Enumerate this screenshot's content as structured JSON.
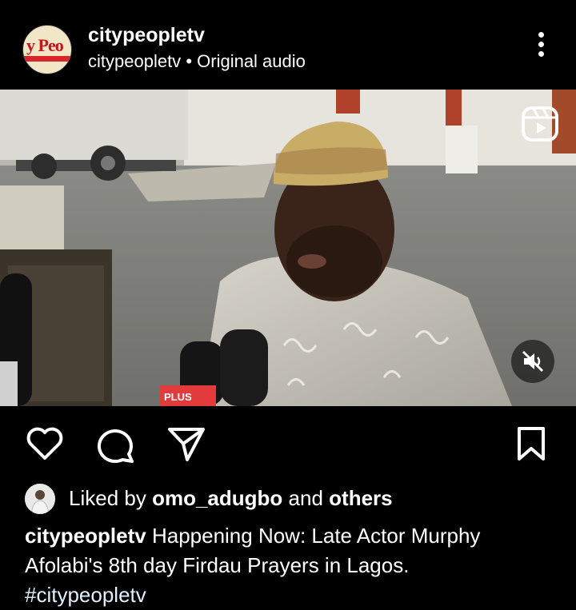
{
  "post": {
    "username": "citypeopletv",
    "subline_user": "citypeopletv",
    "separator": "•",
    "audio": "Original audio",
    "avatar_text": "y Peo"
  },
  "media": {
    "reels_icon": "reels-icon",
    "mute_icon": "speaker-muted-icon",
    "mic_flag_text": "PLUS"
  },
  "actions": {
    "like_icon": "heart-icon",
    "comment_icon": "comment-icon",
    "share_icon": "send-icon",
    "save_icon": "bookmark-icon"
  },
  "likes": {
    "prefix": "Liked by",
    "user": "omo_adugbo",
    "middle": "and",
    "others": "others"
  },
  "caption": {
    "user": "citypeopletv",
    "text": "Happening Now: Late Actor Murphy Afolabi's 8th day Firdau Prayers in Lagos.",
    "hashtag": "#citypeopletv"
  }
}
